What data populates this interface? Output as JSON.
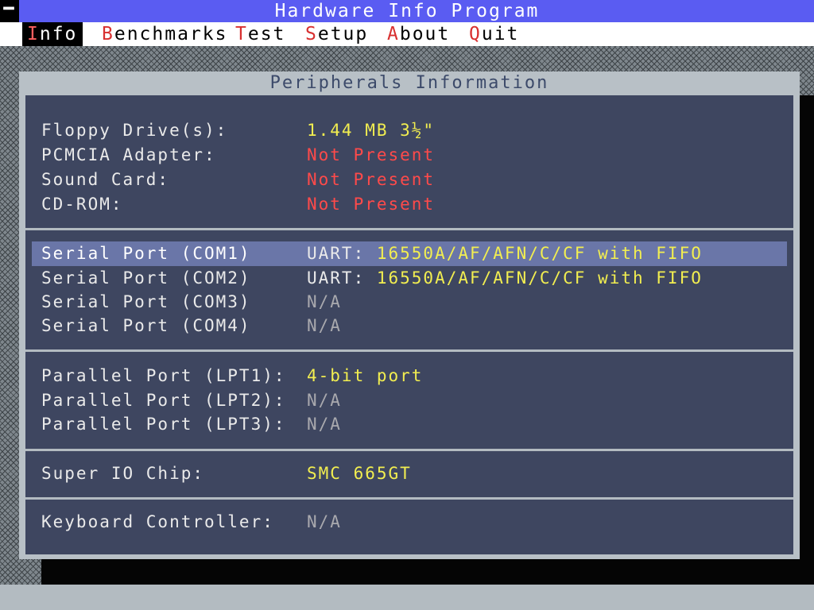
{
  "app": {
    "system_button": "━",
    "title": "Hardware Info Program"
  },
  "menu": {
    "items": [
      {
        "hotkey": "I",
        "rest": "nfo"
      },
      {
        "hotkey": "B",
        "rest": "enchmarks"
      },
      {
        "hotkey": "T",
        "rest": "est"
      },
      {
        "hotkey": "S",
        "rest": "etup"
      },
      {
        "hotkey": "A",
        "rest": "bout"
      },
      {
        "hotkey": "Q",
        "rest": "uit"
      }
    ],
    "active": "Info"
  },
  "window": {
    "title": "Peripherals Information"
  },
  "sections": {
    "drives": [
      {
        "label": "Floppy Drive(s):",
        "value": "1.44 MB 3½\""
      },
      {
        "label": "PCMCIA Adapter:",
        "value": "Not Present"
      },
      {
        "label": "Sound Card:",
        "value": "Not Present"
      },
      {
        "label": "CD-ROM:",
        "value": "Not Present"
      }
    ],
    "serial": [
      {
        "label": "Serial Port (COM1)",
        "prefix": "UART: ",
        "value": "16550A/AF/AFN/C/CF with FIFO"
      },
      {
        "label": "Serial Port (COM2)",
        "prefix": "UART: ",
        "value": "16550A/AF/AFN/C/CF with FIFO"
      },
      {
        "label": "Serial Port (COM3)",
        "value": "N/A"
      },
      {
        "label": "Serial Port (COM4)",
        "value": "N/A"
      }
    ],
    "parallel": [
      {
        "label": "Parallel Port (LPT1):",
        "value": "4-bit port"
      },
      {
        "label": "Parallel Port (LPT2):",
        "value": "N/A"
      },
      {
        "label": "Parallel Port (LPT3):",
        "value": "N/A"
      }
    ],
    "superio": {
      "label": "Super IO Chip:",
      "value": "SMC 665GT"
    },
    "keyboard": {
      "label": "Keyboard Controller:",
      "value": "N/A"
    }
  },
  "colors": {
    "title_bar": "#5a5cf2",
    "panel_background": "#3e4660",
    "selected_row": "#6a76a8",
    "value_present": "#f2ee50",
    "value_absent": "#ff4a4a",
    "value_na": "#a9a9ae"
  }
}
